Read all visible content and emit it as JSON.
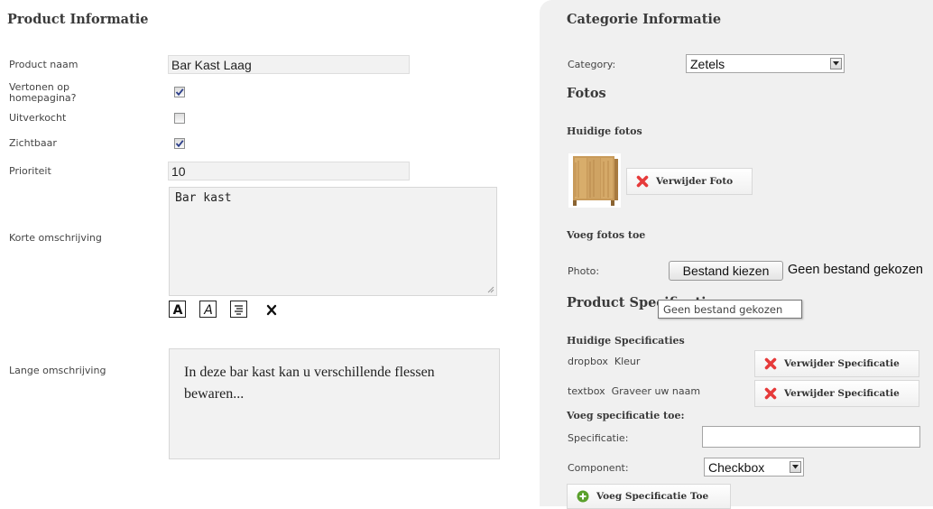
{
  "product_info": {
    "heading": "Product Informatie",
    "fields": {
      "name": {
        "label": "Product naam",
        "value": "Bar Kast Laag"
      },
      "homepage": {
        "label": "Vertonen op homepagina?",
        "checked": true
      },
      "soldout": {
        "label": "Uitverkocht",
        "checked": false
      },
      "visible": {
        "label": "Zichtbaar",
        "checked": true
      },
      "priority": {
        "label": "Prioriteit",
        "value": "10"
      },
      "short_desc": {
        "label": "Korte omschrijving",
        "value": "Bar kast"
      },
      "long_desc": {
        "label": "Lange omschrijving",
        "value": "In deze bar kast kan u verschillende flessen bewaren..."
      }
    },
    "toolbar": {
      "bold_icon": "bold-icon",
      "italic_icon": "italic-icon",
      "paragraph_icon": "paragraph-icon",
      "clear_icon": "clear-format-icon"
    }
  },
  "category_info": {
    "heading": "Categorie Informatie",
    "category_label": "Category:",
    "category_value": "Zetels"
  },
  "photos": {
    "heading": "Fotos",
    "current_heading": "Huidige fotos",
    "delete_button": "Verwijder Foto",
    "add_heading": "Voeg fotos toe",
    "photo_label": "Photo:",
    "file_button": "Bestand kiezen",
    "file_status": "Geen bestand gekozen",
    "tooltip": "Geen bestand gekozen"
  },
  "specs": {
    "heading": "Product Specificaties",
    "current_heading": "Huidige Specificaties",
    "items": [
      {
        "type": "dropbox",
        "name": "Kleur",
        "button": "Verwijder Specificatie"
      },
      {
        "type": "textbox",
        "name": "Graveer uw naam",
        "button": "Verwijder Specificatie"
      }
    ],
    "add_heading": "Voeg specificatie toe:",
    "spec_label": "Specificatie:",
    "spec_value": "",
    "component_label": "Component:",
    "component_value": "Checkbox",
    "add_button": "Voeg Specificatie Toe"
  },
  "colors": {
    "panel_bg": "#f0f0f0",
    "input_bg": "#f2f2f2",
    "delete_red": "#e63a3a",
    "add_green": "#5aa02c"
  }
}
